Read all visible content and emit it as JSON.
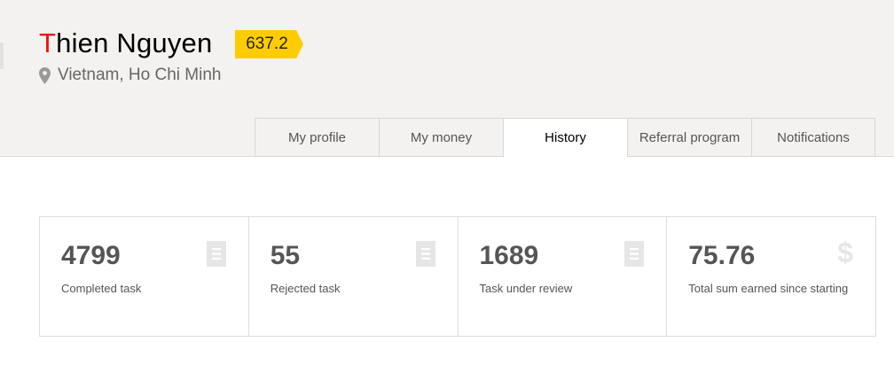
{
  "user": {
    "name_first_letter": "T",
    "name_rest": "hien Nguyen",
    "rating": "637.2",
    "location": "Vietnam, Ho Chi Minh"
  },
  "tabs": [
    {
      "label": "My profile",
      "active": false
    },
    {
      "label": "My money",
      "active": false
    },
    {
      "label": "History",
      "active": true
    },
    {
      "label": "Referral program",
      "active": false
    },
    {
      "label": "Notifications",
      "active": false
    }
  ],
  "stats": [
    {
      "value": "4799",
      "label": "Completed task",
      "icon": "document-icon"
    },
    {
      "value": "55",
      "label": "Rejected task",
      "icon": "document-icon"
    },
    {
      "value": "1689",
      "label": "Task under review",
      "icon": "document-icon"
    },
    {
      "value": "75.76",
      "label": "Total sum earned since starting",
      "icon": "dollar-icon",
      "icon_glyph": "$"
    }
  ],
  "colors": {
    "header_bg": "#f3f2f1",
    "name_accent": "#f00f0f",
    "rating_badge": "#ffcc00",
    "icon_gray": "#e6e6e6"
  }
}
